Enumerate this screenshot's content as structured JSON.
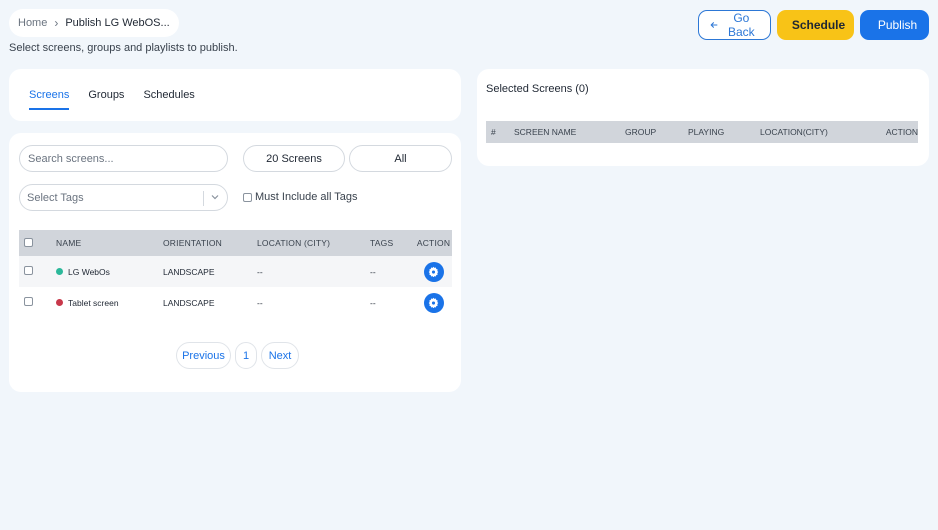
{
  "breadcrumb": {
    "home": "Home",
    "current": "Publish LG WebOS..."
  },
  "subtitle": "Select screens, groups and playlists to publish.",
  "actions": {
    "back": "Go Back",
    "schedule": "Schedule",
    "publish": "Publish"
  },
  "tabs": [
    {
      "label": "Screens",
      "active": true
    },
    {
      "label": "Groups",
      "active": false
    },
    {
      "label": "Schedules",
      "active": false
    }
  ],
  "filters": {
    "search_placeholder": "Search screens...",
    "count": "20 Screens",
    "all": "All",
    "tags_placeholder": "Select Tags",
    "must_include": "Must Include all Tags"
  },
  "screens_table": {
    "headers": {
      "name": "NAME",
      "orientation": "ORIENTATION",
      "location": "LOCATION (CITY)",
      "tags": "TAGS",
      "action": "ACTION"
    },
    "rows": [
      {
        "name": "LG WebOs",
        "status_color": "#2bb89a",
        "orientation": "LANDSCAPE",
        "location": "--",
        "tags": "--"
      },
      {
        "name": "Tablet screen",
        "status_color": "#c8384a",
        "orientation": "LANDSCAPE",
        "location": "--",
        "tags": "--"
      }
    ]
  },
  "pagination": {
    "previous": "Previous",
    "page": "1",
    "next": "Next"
  },
  "selected": {
    "title": "Selected Screens (0)",
    "headers": {
      "num": "#",
      "name": "SCREEN NAME",
      "group": "GROUP",
      "playing": "PLAYING",
      "location": "LOCATION(CITY)",
      "action": "ACTION"
    }
  },
  "colors": {
    "accent": "#1a73e8",
    "schedule": "#f8c317",
    "online": "#2bb89a",
    "offline": "#c8384a"
  }
}
